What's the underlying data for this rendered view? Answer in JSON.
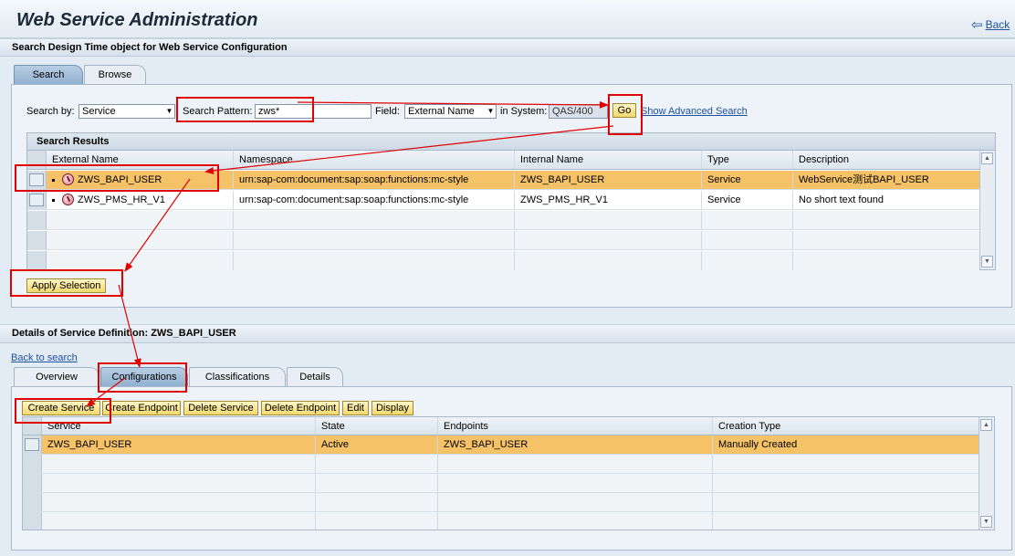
{
  "header": {
    "title": "Web Service Administration",
    "back": "Back"
  },
  "subtitle": "Search Design Time object for Web Service Configuration",
  "top_tabs": [
    {
      "label": "Search",
      "active": true
    },
    {
      "label": "Browse",
      "active": false
    }
  ],
  "search": {
    "search_by_label": "Search by:",
    "search_by_value": "Service",
    "pattern_label": "Search Pattern:",
    "pattern_value": "zws*",
    "field_label": "Field:",
    "field_value": "External Name",
    "system_label": "in System:",
    "system_value": "QAS/400",
    "go": "Go",
    "advanced": "Show Advanced Search"
  },
  "results": {
    "caption": "Search Results",
    "columns": [
      "External Name",
      "Namespace",
      "Internal Name",
      "Type",
      "Description"
    ],
    "rows": [
      [
        "ZWS_BAPI_USER",
        "urn:sap-com:document:sap:soap:functions:mc-style",
        "ZWS_BAPI_USER",
        "Service",
        "WebService测试BAPI_USER"
      ],
      [
        "ZWS_PMS_HR_V1",
        "urn:sap-com:document:sap:soap:functions:mc-style",
        "ZWS_PMS_HR_V1",
        "Service",
        "No short text found"
      ]
    ],
    "selected_row": 0,
    "apply": "Apply Selection"
  },
  "details": {
    "title": "Details of Service Definition: ZWS_BAPI_USER",
    "back_to_search": "Back to search",
    "tabs": [
      {
        "label": "Overview",
        "active": false
      },
      {
        "label": "Configurations",
        "active": true
      },
      {
        "label": "Classifications",
        "active": false
      },
      {
        "label": "Details",
        "active": false
      }
    ],
    "toolbar": [
      "Create Service",
      "Create Endpoint",
      "Delete Service",
      "Delete Endpoint",
      "Edit",
      "Display"
    ],
    "columns": [
      "Service",
      "State",
      "Endpoints",
      "Creation Type"
    ],
    "rows": [
      [
        "ZWS_BAPI_USER",
        "Active",
        "ZWS_BAPI_USER",
        "Manually Created"
      ]
    ],
    "selected_row": 0
  },
  "colors": {
    "selection": "#f5c267",
    "button": "#f2d86d",
    "annotation": "#e00000",
    "link": "#1c50a0"
  }
}
